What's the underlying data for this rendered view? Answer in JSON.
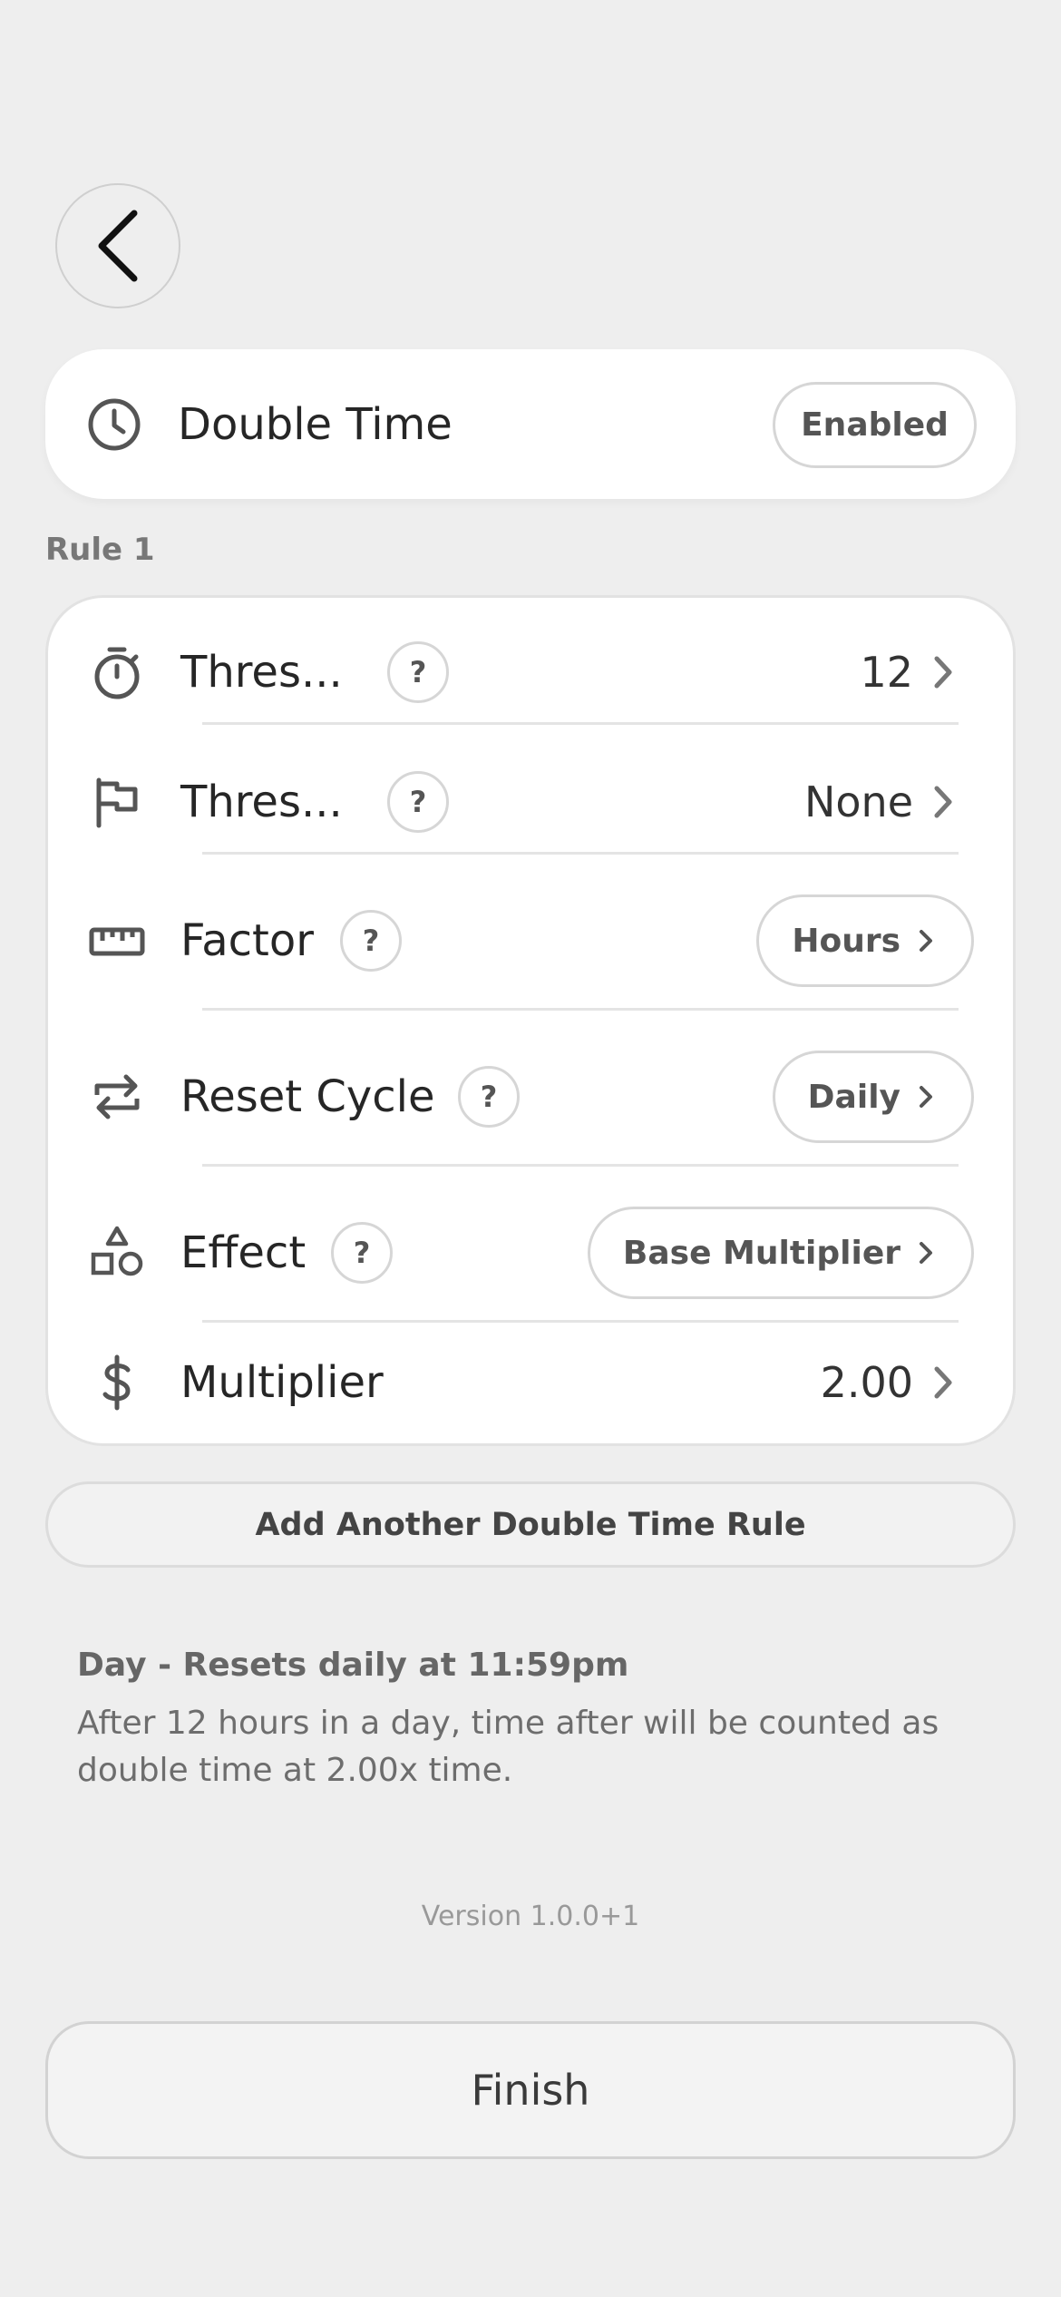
{
  "header": {
    "title": "Double Time",
    "status_button": "Enabled"
  },
  "rule": {
    "label": "Rule 1",
    "rows": [
      {
        "label": "Thres...",
        "help": "?",
        "value": "12"
      },
      {
        "label": "Thres...",
        "help": "?",
        "value": "None"
      },
      {
        "label": "Factor",
        "help": "?",
        "value": "Hours"
      },
      {
        "label": "Reset Cycle",
        "help": "?",
        "value": "Daily"
      },
      {
        "label": "Effect",
        "help": "?",
        "value": "Base Multiplier"
      },
      {
        "label": "Multiplier",
        "value": "2.00"
      }
    ]
  },
  "add_rule_label": "Add Another Double Time Rule",
  "summary": {
    "title": "Day - Resets daily at 11:59pm",
    "text": "After 12 hours in a day, time after will be counted as double time at 2.00x time."
  },
  "version": "Version 1.0.0+1",
  "finish_label": "Finish",
  "icons": {
    "back": "chevron-left-icon",
    "header": "clock-icon",
    "rows": [
      "stopwatch-icon",
      "flag-icon",
      "ruler-icon",
      "repeat-icon",
      "shapes-icon",
      "dollar-icon"
    ]
  }
}
